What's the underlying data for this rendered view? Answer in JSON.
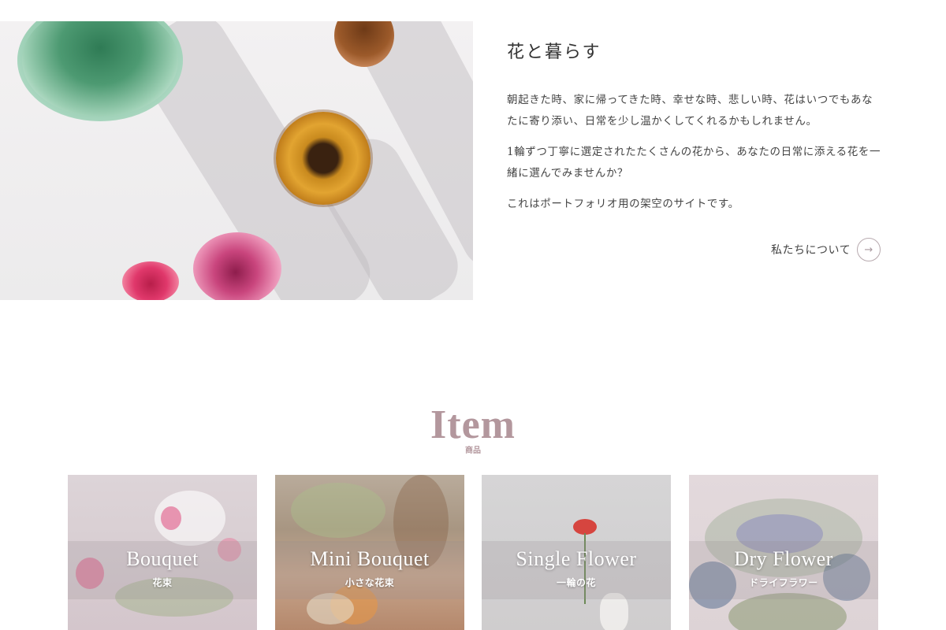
{
  "intro": {
    "title": "花と暮らす",
    "paragraphs": [
      "朝起きた時、家に帰ってきた時、幸せな時、悲しい時、花はいつでもあなたに寄り添い、日常を少し温かくしてくれるかもしれません。",
      "1輪ずつ丁寧に選定されたたくさんの花から、あなたの日常に添える花を一緒に選んでみませんか？",
      "これはポートフォリオ用の架空のサイトです。"
    ],
    "about_link": "私たちについて",
    "arrow_icon": "→"
  },
  "items": {
    "heading": "Item",
    "subheading": "商品",
    "cards": [
      {
        "name": "Bouquet",
        "sub": "花束"
      },
      {
        "name": "Mini Bouquet",
        "sub": "小さな花束"
      },
      {
        "name": "Single Flower",
        "sub": "一輪の花"
      },
      {
        "name": "Dry Flower",
        "sub": "ドライフラワー"
      }
    ]
  },
  "colors": {
    "accent": "#b3979d",
    "text": "#333333"
  }
}
